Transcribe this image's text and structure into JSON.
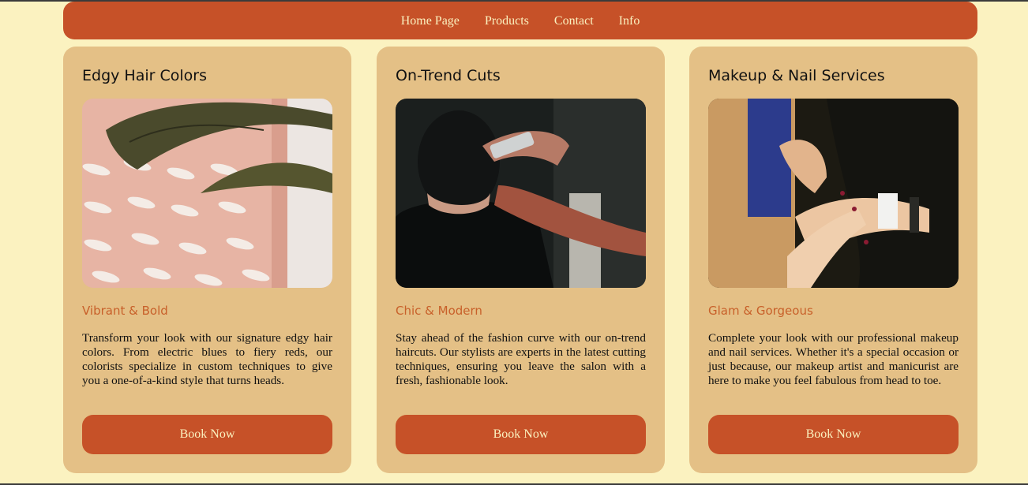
{
  "nav": {
    "items": [
      {
        "label": "Home Page"
      },
      {
        "label": "Products"
      },
      {
        "label": "Contact"
      },
      {
        "label": "Info"
      }
    ]
  },
  "cards": [
    {
      "title": "Edgy Hair Colors",
      "subtitle": "Vibrant & Bold",
      "description": "Transform your look with our signature edgy hair colors. From electric blues to fiery reds, our colorists specialize in custom techniques to give you a one-of-a-kind style that turns heads.",
      "button_label": "Book Now"
    },
    {
      "title": "On-Trend Cuts",
      "subtitle": "Chic & Modern",
      "description": "Stay ahead of the fashion curve with our on-trend haircuts. Our stylists are experts in the latest cutting techniques, ensuring you leave the salon with a fresh, fashionable look.",
      "button_label": "Book Now"
    },
    {
      "title": "Makeup & Nail Services",
      "subtitle": "Glam & Gorgeous",
      "description": "Complete your look with our professional makeup and nail services. Whether it's a special occasion or just because, our makeup artist and manicurist are here to make you feel fabulous from head to toe.",
      "button_label": "Book Now"
    }
  ],
  "colors": {
    "page_background": "#fbf2c0",
    "nav_background": "#c65128",
    "card_background": "#e4c086",
    "accent": "#c8602a",
    "button_text": "#fbf2c0"
  },
  "icons": {
    "card_1_image": "hair-dryer-wall-photo",
    "card_2_image": "barber-haircut-photo",
    "card_3_image": "nail-polish-manicure-photo"
  }
}
